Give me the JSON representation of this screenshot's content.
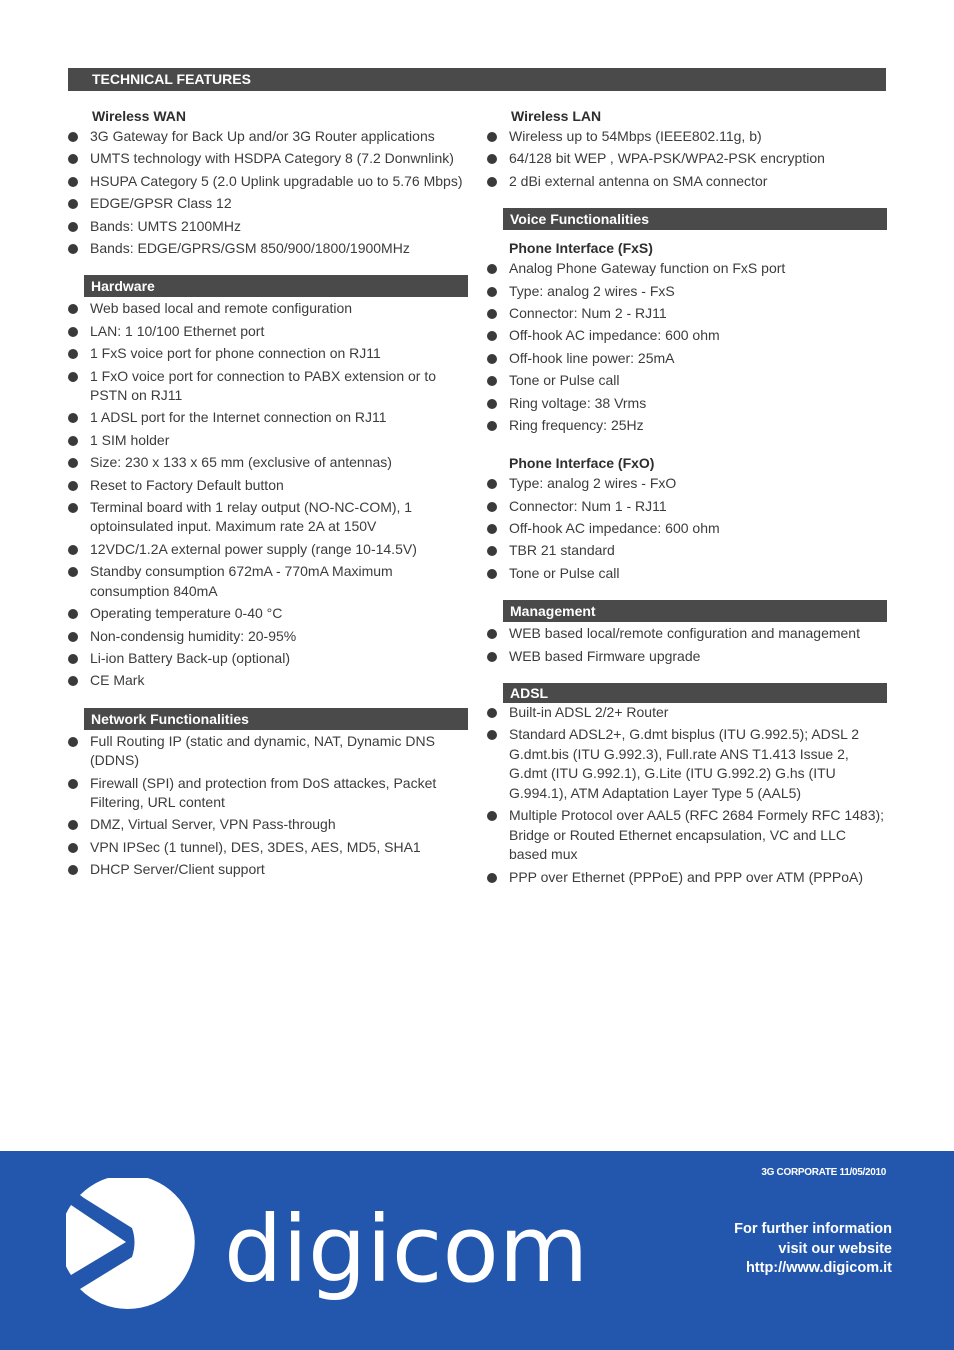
{
  "header": {
    "title": "TECHNICAL FEATURES"
  },
  "left": {
    "wireless_wan": {
      "title": "Wireless WAN",
      "items": [
        "3G Gateway for Back Up and/or 3G Router applications",
        "UMTS technology with HSDPA Category 8 (7.2 Donwnlink)",
        "HSUPA Category 5 (2.0 Uplink upgradable uo to 5.76 Mbps)",
        "EDGE/GPSR Class 12",
        "Bands: UMTS 2100MHz",
        "Bands: EDGE/GPRS/GSM 850/900/1800/1900MHz"
      ]
    },
    "hardware": {
      "title": "Hardware",
      "items": [
        "Web based local and remote configuration",
        "LAN: 1 10/100 Ethernet port",
        "1 FxS voice port for phone connection on RJ11",
        "1 FxO voice port for connection to PABX extension or to PSTN on RJ11",
        "1 ADSL port for the Internet connection on RJ11",
        "1 SIM holder",
        "Size: 230 x 133 x 65 mm (exclusive of antennas)",
        "Reset to Factory Default button",
        "Terminal board with 1 relay output (NO-NC-COM), 1 optoinsulated input. Maximum rate 2A at 150V",
        "12VDC/1.2A external power supply (range 10-14.5V)",
        "Standby consumption 672mA - 770mA Maximum consumption 840mA",
        "Operating temperature 0-40 °C",
        "Non-condensig humidity: 20-95%",
        "Li-ion Battery Back-up (optional)",
        "CE Mark"
      ]
    },
    "network": {
      "title": "Network Functionalities",
      "items": [
        "Full Routing IP (static and dynamic, NAT, Dynamic DNS (DDNS)",
        "Firewall (SPI) and protection from DoS attackes, Packet Filtering, URL content",
        "DMZ, Virtual Server, VPN Pass-through",
        "VPN IPSec (1 tunnel), DES, 3DES, AES, MD5, SHA1",
        "DHCP Server/Client support"
      ]
    }
  },
  "right": {
    "wireless_lan": {
      "title": "Wireless LAN",
      "items": [
        "Wireless up to 54Mbps (IEEE802.11g, b)",
        "64/128 bit WEP , WPA-PSK/WPA2-PSK encryption",
        "2 dBi external antenna on SMA connector"
      ]
    },
    "voice": {
      "title": "Voice Functionalities",
      "fxs": {
        "title": "Phone Interface (FxS)",
        "items": [
          "Analog Phone Gateway function on FxS port",
          "Type: analog 2 wires - FxS",
          "Connector: Num 2 - RJ11",
          "Off-hook AC impedance: 600 ohm",
          "Off-hook line power: 25mA",
          "Tone or Pulse call",
          "Ring voltage: 38 Vrms",
          "Ring frequency: 25Hz"
        ]
      },
      "fxo": {
        "title": "Phone Interface (FxO)",
        "items": [
          "Type: analog 2 wires - FxO",
          "Connector: Num 1 - RJ11",
          "Off-hook AC impedance: 600 ohm",
          "TBR 21 standard",
          "Tone or Pulse call"
        ]
      }
    },
    "management": {
      "title": "Management",
      "items": [
        "WEB based local/remote configuration and management",
        "WEB based Firmware upgrade"
      ]
    },
    "adsl": {
      "title": "ADSL",
      "items": [
        "Built-in ADSL 2/2+ Router",
        "Standard ADSL2+, G.dmt bisplus (ITU G.992.5); ADSL 2 G.dmt.bis (ITU G.992.3), Full.rate ANS T1.413 Issue 2, G.dmt (ITU G.992.1), G.Lite (ITU G.992.2) G.hs (ITU G.994.1), ATM Adaptation Layer Type 5 (AAL5)",
        "Multiple Protocol over AAL5  (RFC 2684 Formely RFC 1483); Bridge or Routed Ethernet encapsulation, VC and LLC based mux",
        "PPP over Ethernet (PPPoE) and PPP over ATM (PPPoA)"
      ]
    }
  },
  "footer": {
    "brand": "digicom",
    "logo_icon": "play-circle-logo-icon",
    "doc_code": "3G CORPORATE  11/05/2010",
    "info_line1": "For further information",
    "info_line2": "visit our website",
    "website": "http://www.digicom.it",
    "background_color": "#2257ad"
  }
}
